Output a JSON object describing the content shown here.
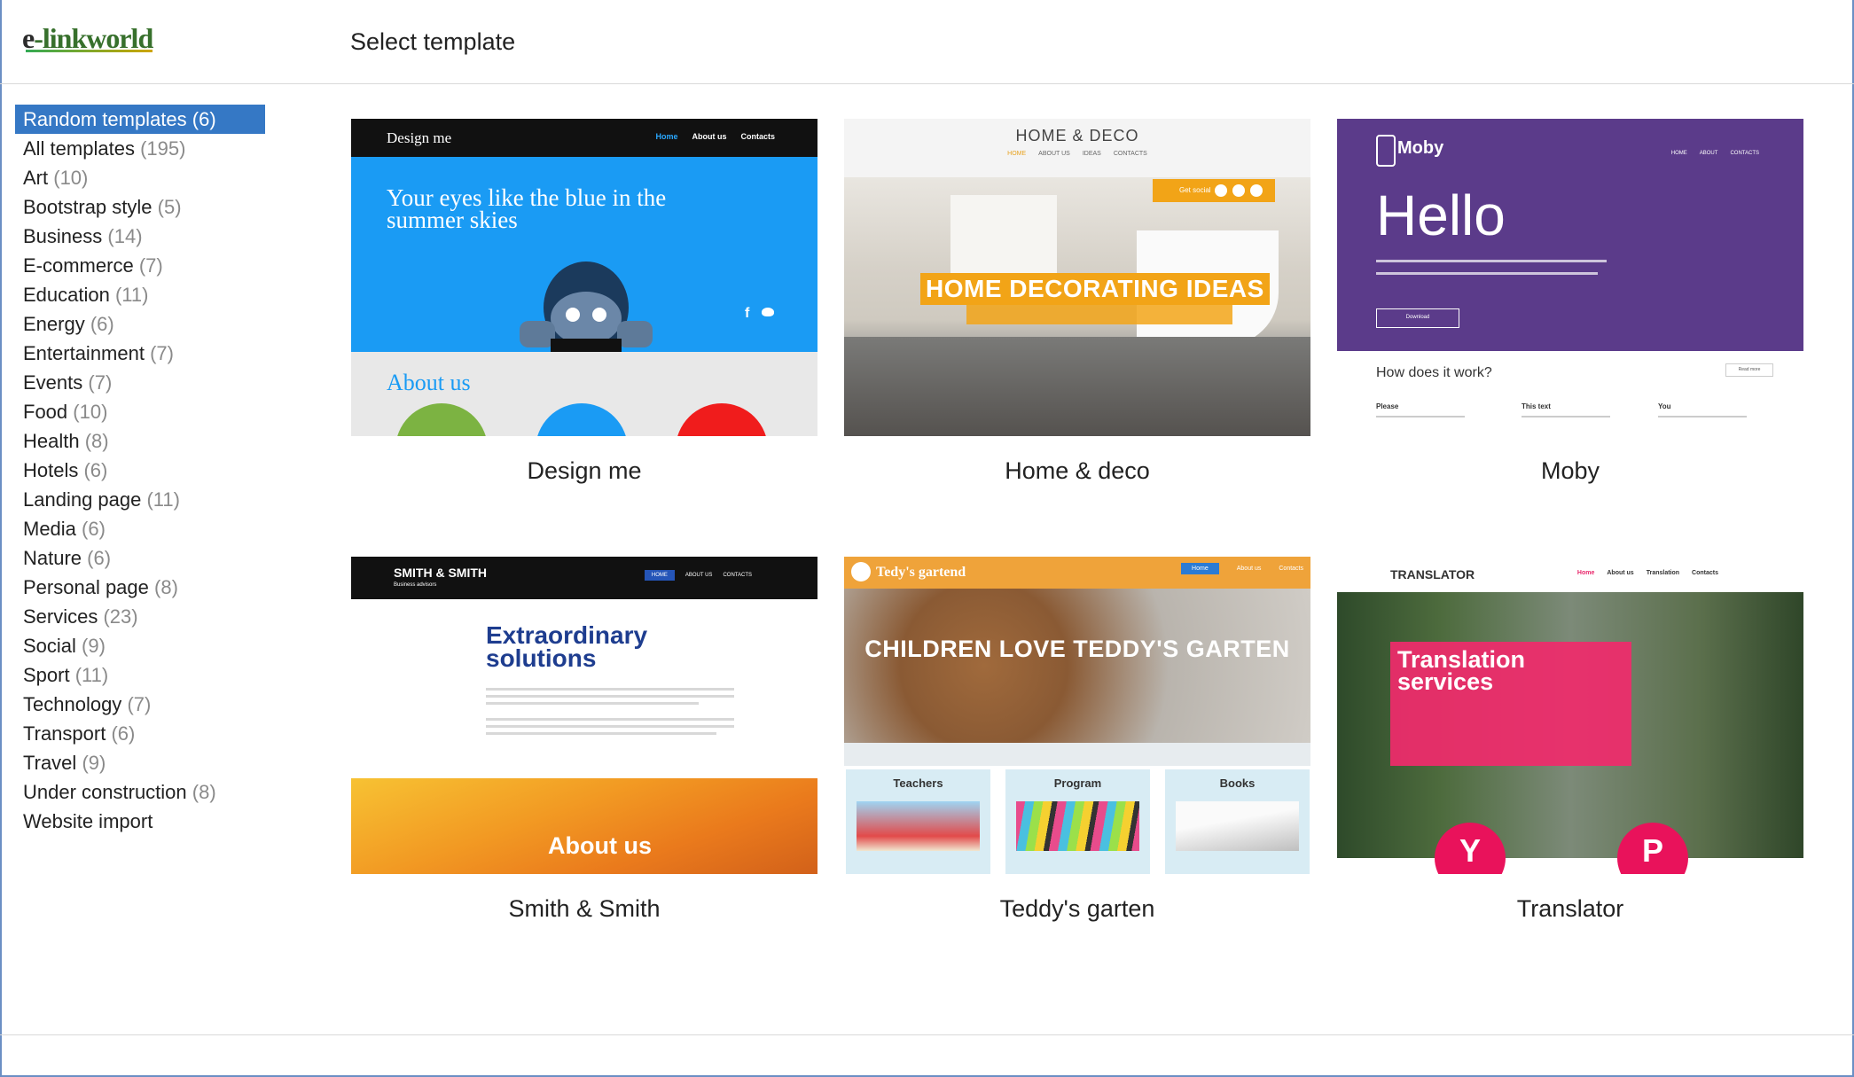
{
  "header": {
    "logo_e": "e",
    "logo_rest": "-linkworld",
    "title": "Select template"
  },
  "sidebar": {
    "categories": [
      {
        "name": "Random templates",
        "count": "(6)"
      },
      {
        "name": "All templates",
        "count": "(195)"
      },
      {
        "name": "Art",
        "count": "(10)"
      },
      {
        "name": "Bootstrap style",
        "count": "(5)"
      },
      {
        "name": "Business",
        "count": "(14)"
      },
      {
        "name": "E-commerce",
        "count": "(7)"
      },
      {
        "name": "Education",
        "count": "(11)"
      },
      {
        "name": "Energy",
        "count": "(6)"
      },
      {
        "name": "Entertainment",
        "count": "(7)"
      },
      {
        "name": "Events",
        "count": "(7)"
      },
      {
        "name": "Food",
        "count": "(10)"
      },
      {
        "name": "Health",
        "count": "(8)"
      },
      {
        "name": "Hotels",
        "count": "(6)"
      },
      {
        "name": "Landing page",
        "count": "(11)"
      },
      {
        "name": "Media",
        "count": "(6)"
      },
      {
        "name": "Nature",
        "count": "(6)"
      },
      {
        "name": "Personal page",
        "count": "(8)"
      },
      {
        "name": "Services",
        "count": "(23)"
      },
      {
        "name": "Social",
        "count": "(9)"
      },
      {
        "name": "Sport",
        "count": "(11)"
      },
      {
        "name": "Technology",
        "count": "(7)"
      },
      {
        "name": "Transport",
        "count": "(6)"
      },
      {
        "name": "Travel",
        "count": "(9)"
      },
      {
        "name": "Under construction",
        "count": "(8)"
      },
      {
        "name": "Website import",
        "count": ""
      }
    ]
  },
  "templates": [
    {
      "title": "Design me",
      "brand": "Design me",
      "nav": [
        "Home",
        "About us",
        "Contacts"
      ],
      "hero_text": "Your eyes like the blue in the summer skies",
      "section_title": "About us"
    },
    {
      "title": "Home & deco",
      "brand": "HOME & DECO",
      "nav": [
        "HOME",
        "ABOUT US",
        "IDEAS",
        "CONTACTS"
      ],
      "social_label": "Get social",
      "hero_text": "HOME DECORATING IDEAS"
    },
    {
      "title": "Moby",
      "brand": "Moby",
      "nav": [
        "HOME",
        "ABOUT",
        "CONTACTS"
      ],
      "hero_text": "Hello",
      "button": "Download",
      "section_title": "How does it work?",
      "columns": [
        "Please",
        "This text",
        "You"
      ],
      "read_more": "Read more"
    },
    {
      "title": "Smith & Smith",
      "brand": "SMITH & SMITH",
      "tagline": "Business advisors",
      "nav": [
        "HOME",
        "ABOUT US",
        "CONTACTS"
      ],
      "hero_text": "Extraordinary solutions",
      "section_title": "About us"
    },
    {
      "title": "Teddy's garten",
      "brand": "Tedy's gartend",
      "nav": [
        "Home",
        "About us",
        "Contacts"
      ],
      "hero_text": "CHILDREN LOVE TEDDY'S GARTEN",
      "boxes": [
        "Teachers",
        "Program",
        "Books"
      ]
    },
    {
      "title": "Translator",
      "brand": "TRANSLATOR",
      "nav": [
        "Home",
        "About us",
        "Translation",
        "Contacts"
      ],
      "hero_text": "Translation services",
      "circles": [
        "Y",
        "P"
      ]
    }
  ]
}
